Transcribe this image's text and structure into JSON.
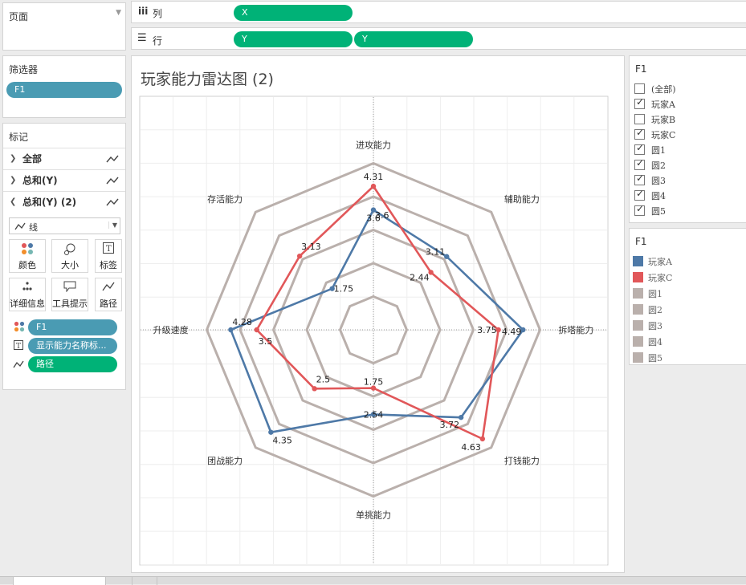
{
  "pages_panel": {
    "title": "页面"
  },
  "shelves": {
    "columns": {
      "icon": "iii",
      "label": "列",
      "pills": [
        "X"
      ]
    },
    "rows": {
      "icon": "☰",
      "label": "行",
      "pills": [
        "Y",
        "Y"
      ]
    }
  },
  "filters": {
    "title": "筛选器",
    "pills": [
      "F1"
    ]
  },
  "marks": {
    "title": "标记",
    "rows": [
      {
        "label": "全部"
      },
      {
        "label": "总和(Y)"
      },
      {
        "label": "总和(Y) (2)"
      }
    ],
    "mark_type": "线",
    "buttons": [
      "颜色",
      "大小",
      "标签",
      "详细信息",
      "工具提示",
      "路径"
    ],
    "fields": [
      "F1",
      "显示能力名称标...",
      "路径"
    ]
  },
  "chart": {
    "title": "玩家能力雷达图 (2)"
  },
  "chart_data": {
    "type": "radar",
    "axes": [
      "进攻能力",
      "辅助能力",
      "拆塔能力",
      "打钱能力",
      "单挑能力",
      "团战能力",
      "升级速度",
      "存活能力"
    ],
    "series": [
      {
        "name": "玩家A",
        "color": "#4e79a7",
        "values": [
          3.6,
          3.11,
          4.49,
          3.72,
          2.54,
          4.35,
          4.28,
          1.75
        ],
        "labels": [
          "3.6",
          "3.11",
          "4.49",
          "3.72",
          "2.54",
          "4.35",
          "4.28",
          "1.75"
        ]
      },
      {
        "name": "玩家C",
        "color": "#e15759",
        "values": [
          4.31,
          2.44,
          3.75,
          4.63,
          1.75,
          2.5,
          3.5,
          3.13
        ],
        "labels": [
          "4.31",
          "2.44",
          "3.75",
          "4.63",
          "1.75",
          "2.5",
          "3.5",
          "3.13"
        ]
      }
    ],
    "rings": [
      {
        "name": "圆1",
        "value": 1
      },
      {
        "name": "圆2",
        "value": 2
      },
      {
        "name": "圆3",
        "value": 3
      },
      {
        "name": "圆4",
        "value": 4
      },
      {
        "name": "圆5",
        "value": 5
      }
    ],
    "ring_color": "#bab0ac",
    "extra_labels": [
      {
        "text": "3.6",
        "series": 1,
        "axis": 0
      }
    ]
  },
  "filter_card": {
    "title": "F1",
    "items": [
      {
        "label": "(全部)",
        "checked": false
      },
      {
        "label": "玩家A",
        "checked": true
      },
      {
        "label": "玩家B",
        "checked": false
      },
      {
        "label": "玩家C",
        "checked": true
      },
      {
        "label": "圆1",
        "checked": true
      },
      {
        "label": "圆2",
        "checked": true
      },
      {
        "label": "圆3",
        "checked": true
      },
      {
        "label": "圆4",
        "checked": true
      },
      {
        "label": "圆5",
        "checked": true
      }
    ]
  },
  "legend_card": {
    "title": "F1",
    "items": [
      {
        "label": "玩家A",
        "color": "#4e79a7"
      },
      {
        "label": "玩家C",
        "color": "#e15759"
      },
      {
        "label": "圆1",
        "color": "#bab0ac"
      },
      {
        "label": "圆2",
        "color": "#bab0ac"
      },
      {
        "label": "圆3",
        "color": "#bab0ac"
      },
      {
        "label": "圆4",
        "color": "#bab0ac"
      },
      {
        "label": "圆5",
        "color": "#bab0ac"
      }
    ]
  }
}
